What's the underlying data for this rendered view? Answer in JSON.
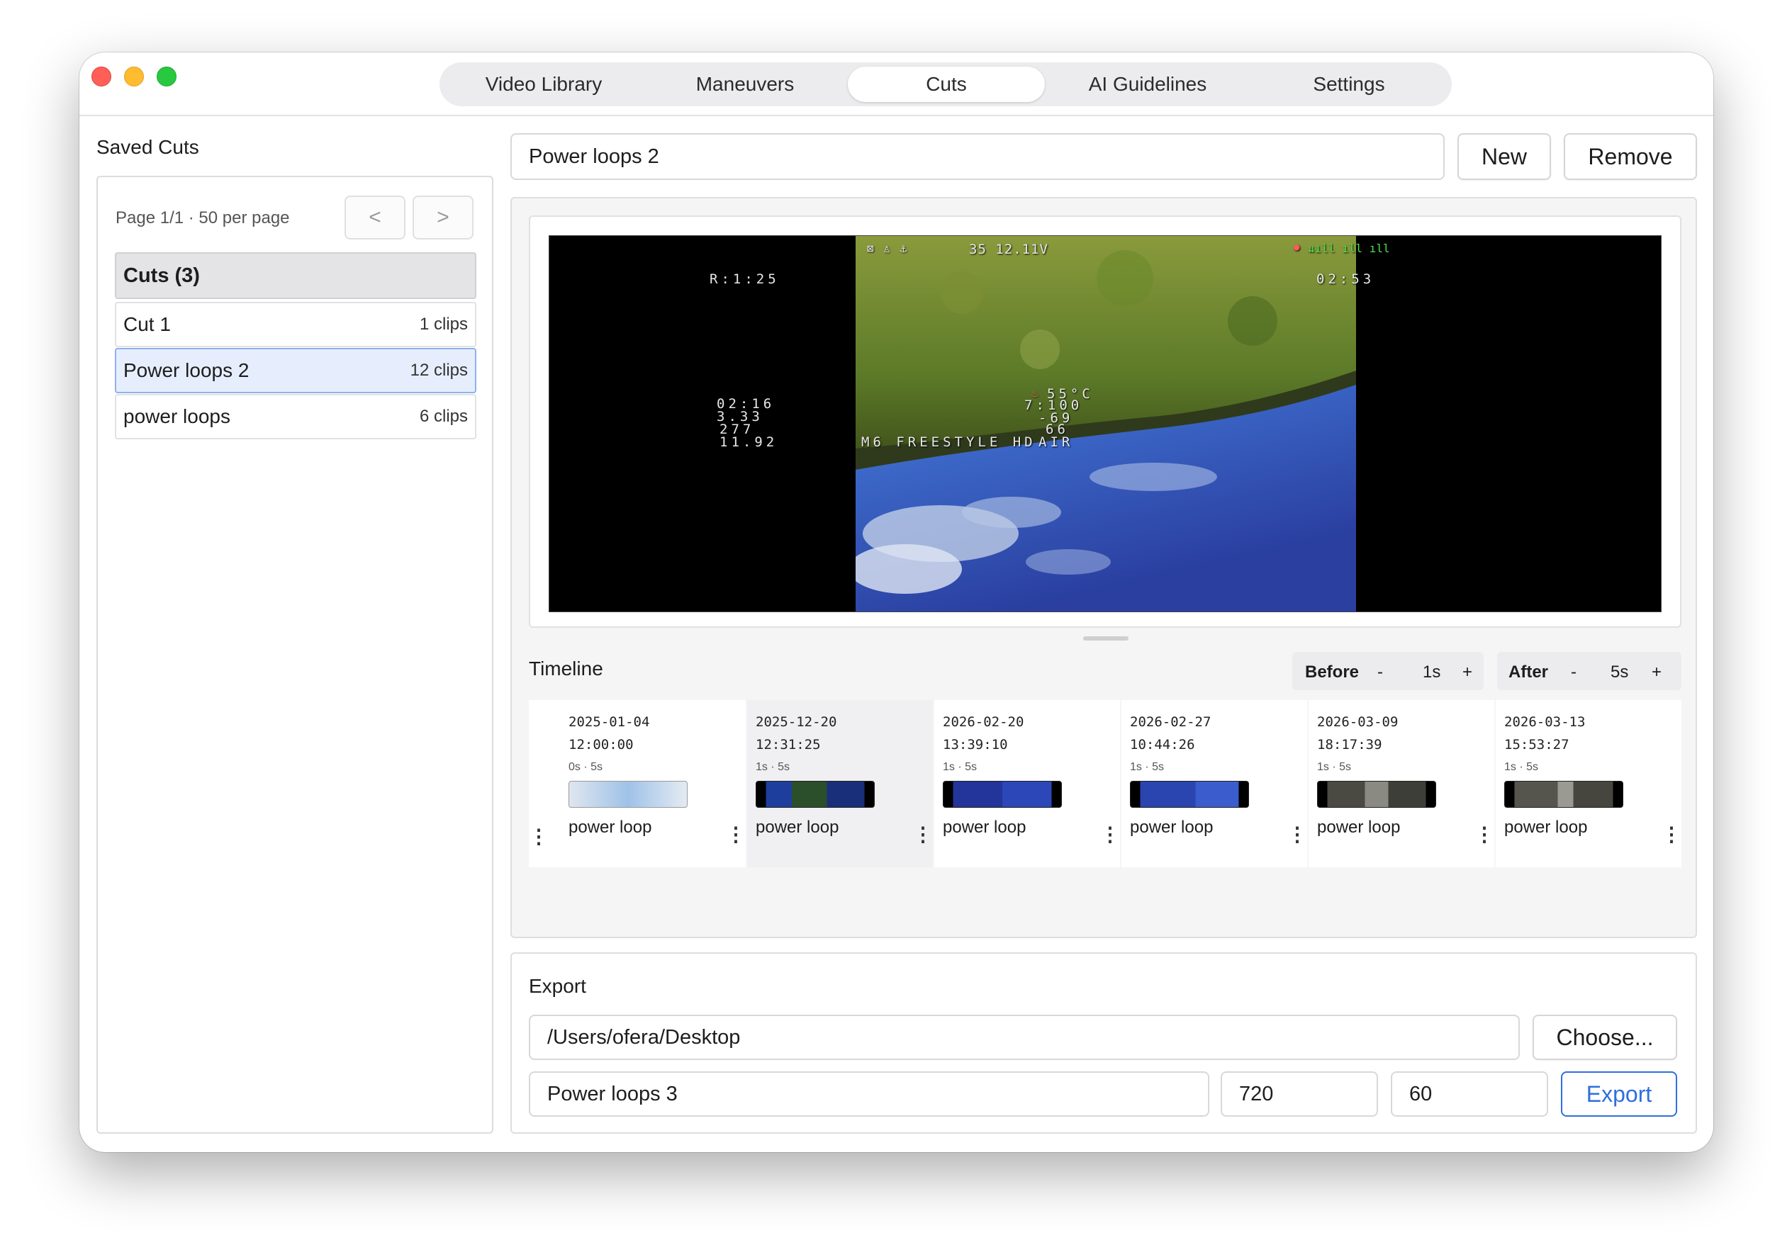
{
  "tabs": [
    {
      "label": "Video Library",
      "active": false
    },
    {
      "label": "Maneuvers",
      "active": false
    },
    {
      "label": "Cuts",
      "active": true
    },
    {
      "label": "AI Guidelines",
      "active": false
    },
    {
      "label": "Settings",
      "active": false
    }
  ],
  "sidebar": {
    "title": "Saved Cuts",
    "pager_text": "Page 1/1 · 50 per page",
    "prev_label": "<",
    "next_label": ">",
    "list_header": "Cuts (3)",
    "cuts": [
      {
        "name": "Cut 1",
        "count": "1 clips",
        "selected": false
      },
      {
        "name": "Power loops 2",
        "count": "12 clips",
        "selected": true
      },
      {
        "name": "power loops",
        "count": "6 clips",
        "selected": false
      }
    ]
  },
  "editor": {
    "cut_name": "Power loops 2",
    "new_label": "New",
    "remove_label": "Remove"
  },
  "osd": {
    "top_center": "35 12.11V",
    "r_time": "R:1:25",
    "flight_time": "02:53",
    "left_1": "02:16",
    "left_2": "3.33",
    "left_3": "277",
    "left_4": "11.92",
    "right_1": "55°C",
    "right_2": "7:100",
    "right_3": "-69",
    "right_4": "66",
    "right_5": "AIR",
    "bottom": "M6 FREESTYLE HD"
  },
  "timeline": {
    "title": "Timeline",
    "before": {
      "label": "Before",
      "minus": "-",
      "value": "1s",
      "plus": "+"
    },
    "after": {
      "label": "After",
      "minus": "-",
      "value": "5s",
      "plus": "+"
    },
    "clips": [
      {
        "date": "2025-01-04",
        "time": "12:00:00",
        "range": "0s · 5s",
        "label": "power loop",
        "more": "⋮"
      },
      {
        "date": "2025-12-20",
        "time": "12:31:25",
        "range": "1s · 5s",
        "label": "power loop",
        "more": "⋮"
      },
      {
        "date": "2026-02-20",
        "time": "13:39:10",
        "range": "1s · 5s",
        "label": "power loop",
        "more": "⋮"
      },
      {
        "date": "2026-02-27",
        "time": "10:44:26",
        "range": "1s · 5s",
        "label": "power loop",
        "more": "⋮"
      },
      {
        "date": "2026-03-09",
        "time": "18:17:39",
        "range": "1s · 5s",
        "label": "power loop",
        "more": "⋮"
      },
      {
        "date": "2026-03-13",
        "time": "15:53:27",
        "range": "1s · 5s",
        "label": "power loop",
        "more": "⋮"
      }
    ],
    "lead_more": "⋮"
  },
  "export": {
    "title": "Export",
    "path": "/Users/ofera/Desktop",
    "choose_label": "Choose...",
    "output_name": "Power loops 3",
    "resolution": "720",
    "fps": "60",
    "export_label": "Export"
  },
  "colors": {
    "accent": "#2f6fde",
    "selected_row": "#e6eefd",
    "traffic_red": "#ff5f57",
    "traffic_yellow": "#febc2e",
    "traffic_green": "#28c840"
  }
}
